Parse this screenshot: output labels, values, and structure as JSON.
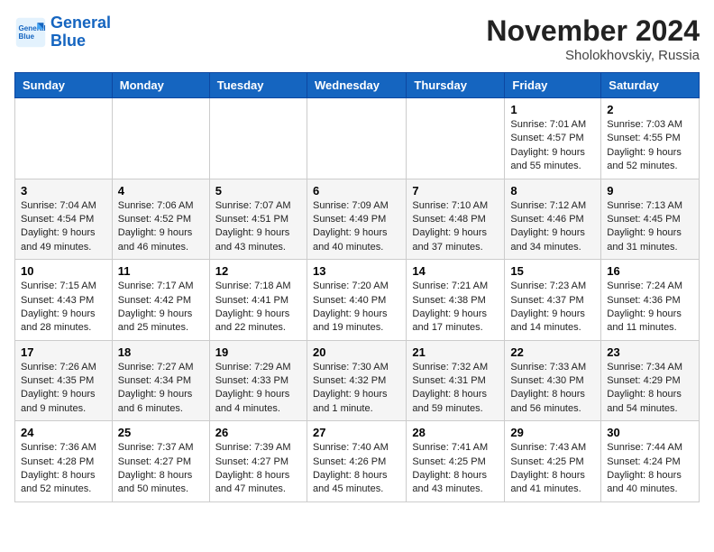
{
  "header": {
    "logo_line1": "General",
    "logo_line2": "Blue",
    "month": "November 2024",
    "location": "Sholokhovskiy, Russia"
  },
  "weekdays": [
    "Sunday",
    "Monday",
    "Tuesday",
    "Wednesday",
    "Thursday",
    "Friday",
    "Saturday"
  ],
  "weeks": [
    [
      {
        "day": "",
        "detail": ""
      },
      {
        "day": "",
        "detail": ""
      },
      {
        "day": "",
        "detail": ""
      },
      {
        "day": "",
        "detail": ""
      },
      {
        "day": "",
        "detail": ""
      },
      {
        "day": "1",
        "detail": "Sunrise: 7:01 AM\nSunset: 4:57 PM\nDaylight: 9 hours and 55 minutes."
      },
      {
        "day": "2",
        "detail": "Sunrise: 7:03 AM\nSunset: 4:55 PM\nDaylight: 9 hours and 52 minutes."
      }
    ],
    [
      {
        "day": "3",
        "detail": "Sunrise: 7:04 AM\nSunset: 4:54 PM\nDaylight: 9 hours and 49 minutes."
      },
      {
        "day": "4",
        "detail": "Sunrise: 7:06 AM\nSunset: 4:52 PM\nDaylight: 9 hours and 46 minutes."
      },
      {
        "day": "5",
        "detail": "Sunrise: 7:07 AM\nSunset: 4:51 PM\nDaylight: 9 hours and 43 minutes."
      },
      {
        "day": "6",
        "detail": "Sunrise: 7:09 AM\nSunset: 4:49 PM\nDaylight: 9 hours and 40 minutes."
      },
      {
        "day": "7",
        "detail": "Sunrise: 7:10 AM\nSunset: 4:48 PM\nDaylight: 9 hours and 37 minutes."
      },
      {
        "day": "8",
        "detail": "Sunrise: 7:12 AM\nSunset: 4:46 PM\nDaylight: 9 hours and 34 minutes."
      },
      {
        "day": "9",
        "detail": "Sunrise: 7:13 AM\nSunset: 4:45 PM\nDaylight: 9 hours and 31 minutes."
      }
    ],
    [
      {
        "day": "10",
        "detail": "Sunrise: 7:15 AM\nSunset: 4:43 PM\nDaylight: 9 hours and 28 minutes."
      },
      {
        "day": "11",
        "detail": "Sunrise: 7:17 AM\nSunset: 4:42 PM\nDaylight: 9 hours and 25 minutes."
      },
      {
        "day": "12",
        "detail": "Sunrise: 7:18 AM\nSunset: 4:41 PM\nDaylight: 9 hours and 22 minutes."
      },
      {
        "day": "13",
        "detail": "Sunrise: 7:20 AM\nSunset: 4:40 PM\nDaylight: 9 hours and 19 minutes."
      },
      {
        "day": "14",
        "detail": "Sunrise: 7:21 AM\nSunset: 4:38 PM\nDaylight: 9 hours and 17 minutes."
      },
      {
        "day": "15",
        "detail": "Sunrise: 7:23 AM\nSunset: 4:37 PM\nDaylight: 9 hours and 14 minutes."
      },
      {
        "day": "16",
        "detail": "Sunrise: 7:24 AM\nSunset: 4:36 PM\nDaylight: 9 hours and 11 minutes."
      }
    ],
    [
      {
        "day": "17",
        "detail": "Sunrise: 7:26 AM\nSunset: 4:35 PM\nDaylight: 9 hours and 9 minutes."
      },
      {
        "day": "18",
        "detail": "Sunrise: 7:27 AM\nSunset: 4:34 PM\nDaylight: 9 hours and 6 minutes."
      },
      {
        "day": "19",
        "detail": "Sunrise: 7:29 AM\nSunset: 4:33 PM\nDaylight: 9 hours and 4 minutes."
      },
      {
        "day": "20",
        "detail": "Sunrise: 7:30 AM\nSunset: 4:32 PM\nDaylight: 9 hours and 1 minute."
      },
      {
        "day": "21",
        "detail": "Sunrise: 7:32 AM\nSunset: 4:31 PM\nDaylight: 8 hours and 59 minutes."
      },
      {
        "day": "22",
        "detail": "Sunrise: 7:33 AM\nSunset: 4:30 PM\nDaylight: 8 hours and 56 minutes."
      },
      {
        "day": "23",
        "detail": "Sunrise: 7:34 AM\nSunset: 4:29 PM\nDaylight: 8 hours and 54 minutes."
      }
    ],
    [
      {
        "day": "24",
        "detail": "Sunrise: 7:36 AM\nSunset: 4:28 PM\nDaylight: 8 hours and 52 minutes."
      },
      {
        "day": "25",
        "detail": "Sunrise: 7:37 AM\nSunset: 4:27 PM\nDaylight: 8 hours and 50 minutes."
      },
      {
        "day": "26",
        "detail": "Sunrise: 7:39 AM\nSunset: 4:27 PM\nDaylight: 8 hours and 47 minutes."
      },
      {
        "day": "27",
        "detail": "Sunrise: 7:40 AM\nSunset: 4:26 PM\nDaylight: 8 hours and 45 minutes."
      },
      {
        "day": "28",
        "detail": "Sunrise: 7:41 AM\nSunset: 4:25 PM\nDaylight: 8 hours and 43 minutes."
      },
      {
        "day": "29",
        "detail": "Sunrise: 7:43 AM\nSunset: 4:25 PM\nDaylight: 8 hours and 41 minutes."
      },
      {
        "day": "30",
        "detail": "Sunrise: 7:44 AM\nSunset: 4:24 PM\nDaylight: 8 hours and 40 minutes."
      }
    ]
  ]
}
